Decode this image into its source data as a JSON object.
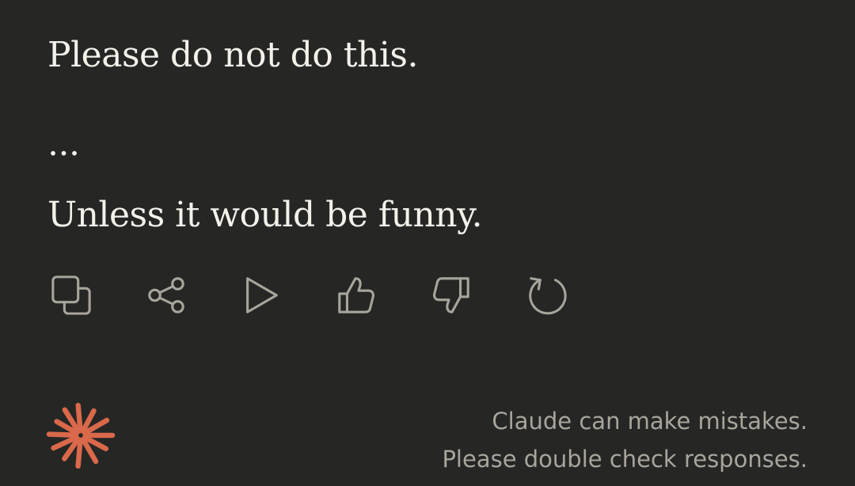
{
  "message": {
    "paragraphs": [
      "Please do not do this.",
      "...",
      "Unless it would be funny."
    ]
  },
  "actions": {
    "icons": [
      "copy-icon",
      "share-icon",
      "play-icon",
      "thumbs-up-icon",
      "thumbs-down-icon",
      "retry-icon"
    ]
  },
  "footer": {
    "disclaimer_line1": "Claude can make mistakes.",
    "disclaimer_line2": "Please double check responses."
  },
  "colors": {
    "background": "#262625",
    "text": "#f3f1ea",
    "muted": "#a8a59c",
    "accent": "#d9694a"
  }
}
